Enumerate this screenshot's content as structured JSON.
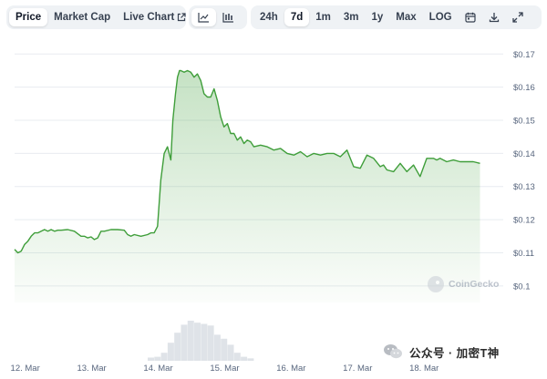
{
  "toolbar": {
    "tabs": [
      {
        "label": "Price",
        "active": true
      },
      {
        "label": "Market Cap",
        "active": false
      },
      {
        "label": "Live Chart",
        "active": false
      }
    ],
    "chart_types": [
      {
        "icon": "line-chart-icon",
        "active": true
      },
      {
        "icon": "candlestick-icon",
        "active": false
      }
    ],
    "ranges": [
      {
        "label": "24h",
        "active": false
      },
      {
        "label": "7d",
        "active": true
      },
      {
        "label": "1m",
        "active": false
      },
      {
        "label": "3m",
        "active": false
      },
      {
        "label": "1y",
        "active": false
      },
      {
        "label": "Max",
        "active": false
      },
      {
        "label": "LOG",
        "active": false
      }
    ],
    "tools": [
      "calendar-icon",
      "download-icon",
      "expand-icon"
    ]
  },
  "watermark": {
    "text": "CoinGecko"
  },
  "wechat": {
    "text": "公众号 · 加密T神"
  },
  "colors": {
    "line": "#3f9e3a",
    "fill_top": "#cfe8cf",
    "grid": "#e8ecf0",
    "axis_text": "#58667e",
    "volume": "#dfe3e8"
  },
  "chart_data": {
    "type": "area",
    "title": "",
    "xlabel": "",
    "ylabel": "",
    "ylim": [
      0.095,
      0.172
    ],
    "xlim": [
      0,
      7.35
    ],
    "y_ticks": [
      0.1,
      0.11,
      0.12,
      0.13,
      0.14,
      0.15,
      0.16,
      0.17
    ],
    "y_tick_labels": [
      "$0.1",
      "$0.11",
      "$0.12",
      "$0.13",
      "$0.14",
      "$0.15",
      "$0.16",
      "$0.17"
    ],
    "x_ticks": [
      0.16,
      1.16,
      2.16,
      3.16,
      4.16,
      5.16,
      6.16
    ],
    "x_tick_labels": [
      "12. Mar",
      "13. Mar",
      "14. Mar",
      "15. Mar",
      "16. Mar",
      "17. Mar",
      "18. Mar"
    ],
    "grid": true,
    "series": [
      {
        "x": [
          0.0,
          0.05,
          0.1,
          0.15,
          0.2,
          0.25,
          0.3,
          0.35,
          0.4,
          0.45,
          0.5,
          0.55,
          0.6,
          0.65,
          0.7,
          0.8,
          0.9,
          1.0,
          1.05,
          1.1,
          1.15,
          1.2,
          1.25,
          1.3,
          1.35,
          1.45,
          1.55,
          1.65,
          1.7,
          1.75,
          1.8,
          1.9,
          2.0,
          2.05,
          2.1,
          2.15,
          2.2,
          2.25,
          2.3,
          2.35,
          2.38,
          2.42,
          2.45,
          2.48,
          2.5,
          2.55,
          2.6,
          2.65,
          2.7,
          2.75,
          2.8,
          2.85,
          2.9,
          2.95,
          3.0,
          3.05,
          3.1,
          3.15,
          3.2,
          3.25,
          3.3,
          3.35,
          3.4,
          3.45,
          3.5,
          3.55,
          3.6,
          3.7,
          3.8,
          3.9,
          4.0,
          4.1,
          4.2,
          4.3,
          4.4,
          4.5,
          4.6,
          4.7,
          4.8,
          4.9,
          5.0,
          5.1,
          5.2,
          5.3,
          5.4,
          5.5,
          5.55,
          5.6,
          5.7,
          5.8,
          5.9,
          6.0,
          6.1,
          6.2,
          6.3,
          6.35,
          6.4,
          6.5,
          6.6,
          6.7,
          6.8,
          6.9,
          7.0
        ],
        "values": [
          0.111,
          0.11,
          0.1105,
          0.1125,
          0.1135,
          0.115,
          0.116,
          0.116,
          0.1165,
          0.117,
          0.1165,
          0.117,
          0.1165,
          0.1168,
          0.1168,
          0.117,
          0.1165,
          0.115,
          0.115,
          0.1145,
          0.1148,
          0.114,
          0.1145,
          0.1165,
          0.1165,
          0.117,
          0.117,
          0.1168,
          0.1155,
          0.115,
          0.1155,
          0.115,
          0.1155,
          0.116,
          0.116,
          0.118,
          0.132,
          0.14,
          0.142,
          0.138,
          0.15,
          0.158,
          0.163,
          0.165,
          0.165,
          0.1645,
          0.165,
          0.1645,
          0.163,
          0.164,
          0.162,
          0.158,
          0.157,
          0.157,
          0.1595,
          0.156,
          0.151,
          0.148,
          0.149,
          0.146,
          0.146,
          0.144,
          0.145,
          0.143,
          0.144,
          0.1435,
          0.142,
          0.1425,
          0.142,
          0.141,
          0.1415,
          0.14,
          0.1395,
          0.1405,
          0.139,
          0.14,
          0.1395,
          0.14,
          0.14,
          0.139,
          0.141,
          0.136,
          0.1355,
          0.1395,
          0.1385,
          0.136,
          0.1365,
          0.135,
          0.1345,
          0.137,
          0.1345,
          0.1365,
          0.133,
          0.1385,
          0.1385,
          0.138,
          0.1385,
          0.1375,
          0.138,
          0.1375,
          0.1375,
          0.1375,
          0.137
        ]
      }
    ],
    "volume": {
      "x": [
        2.05,
        2.15,
        2.25,
        2.35,
        2.45,
        2.55,
        2.65,
        2.75,
        2.85,
        2.95,
        3.05,
        3.15,
        3.25,
        3.35,
        3.45,
        3.55
      ],
      "values": [
        0.08,
        0.1,
        0.2,
        0.45,
        0.7,
        0.9,
        1.0,
        0.95,
        0.92,
        0.88,
        0.65,
        0.55,
        0.4,
        0.2,
        0.1,
        0.06
      ]
    }
  }
}
